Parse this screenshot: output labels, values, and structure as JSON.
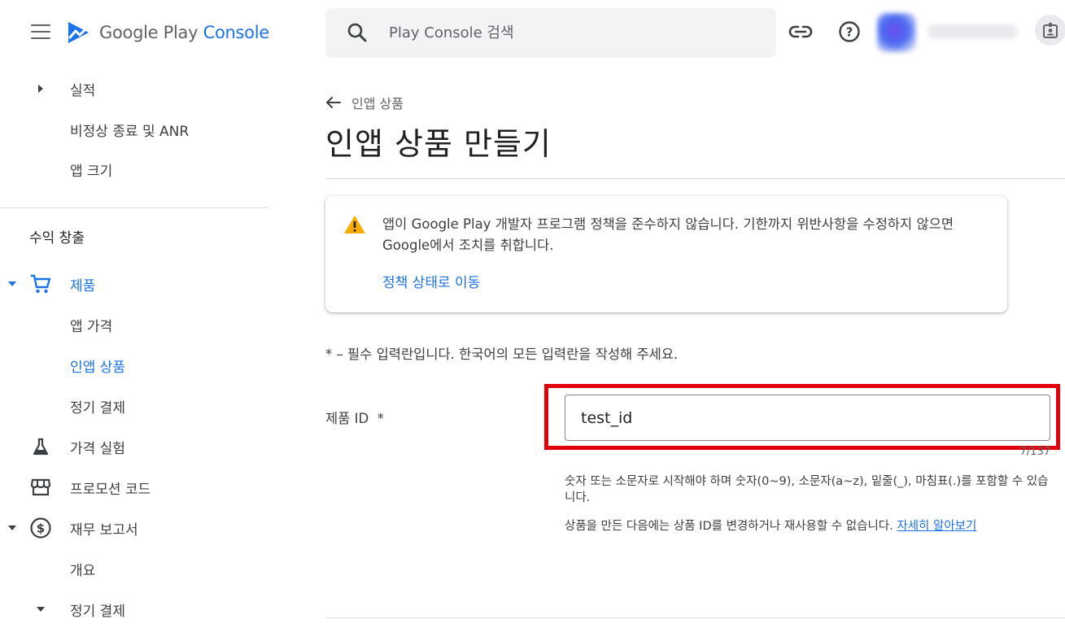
{
  "app": {
    "brand_google_play": "Google Play",
    "brand_console": "Console"
  },
  "colors": {
    "accent": "#1a73e8",
    "highlight": "#e2000d",
    "warning": "#f9ab00",
    "text": "#202124",
    "secondary_text": "#5f6368"
  },
  "sidebar": {
    "items_top": [
      {
        "label": "실적",
        "icon": "caret-right-icon"
      },
      {
        "label": "비정상 종료 및 ANR"
      },
      {
        "label": "앱 크기"
      }
    ],
    "section_title": "수익 창출",
    "products": {
      "label": "제품",
      "icon": "cart-icon"
    },
    "product_children": [
      {
        "label": "앱 가격"
      },
      {
        "label": "인앱 상품"
      },
      {
        "label": "정기 결제"
      }
    ],
    "items_bottom": [
      {
        "label": "가격 실험",
        "icon": "flask-icon"
      },
      {
        "label": "프로모션 코드",
        "icon": "store-icon"
      },
      {
        "label": "재무 보고서",
        "icon": "dollar-icon"
      },
      {
        "label": "개요"
      },
      {
        "label": "정기 결제"
      }
    ]
  },
  "search": {
    "placeholder": "Play Console 검색"
  },
  "header": {
    "breadcrumb": "인앱 상품",
    "page_title": "인앱 상품 만들기"
  },
  "warning": {
    "text": "앱이 Google Play 개발자 프로그램 정책을 준수하지 않습니다. 기한까지 위반사항을 수정하지 않으면 Google에서 조치를 취합니다.",
    "link": "정책 상태로 이동"
  },
  "form": {
    "required_note": "* – 필수 입력란입니다. 한국어의 모든 입력란을 작성해 주세요.",
    "product_id_label": "제품 ID  *",
    "product_id_value": "test_id",
    "char_counter": "7/137",
    "hint1": "숫자 또는 소문자로 시작해야 하며 숫자(0~9), 소문자(a~z), 밑줄(_), 마침표(.)를 포함할 수 있습니다.",
    "hint2": "상품을 만든 다음에는 상품 ID를 변경하거나 재사용할 수 없습니다. ",
    "hint2_link": "자세히 알아보기"
  }
}
